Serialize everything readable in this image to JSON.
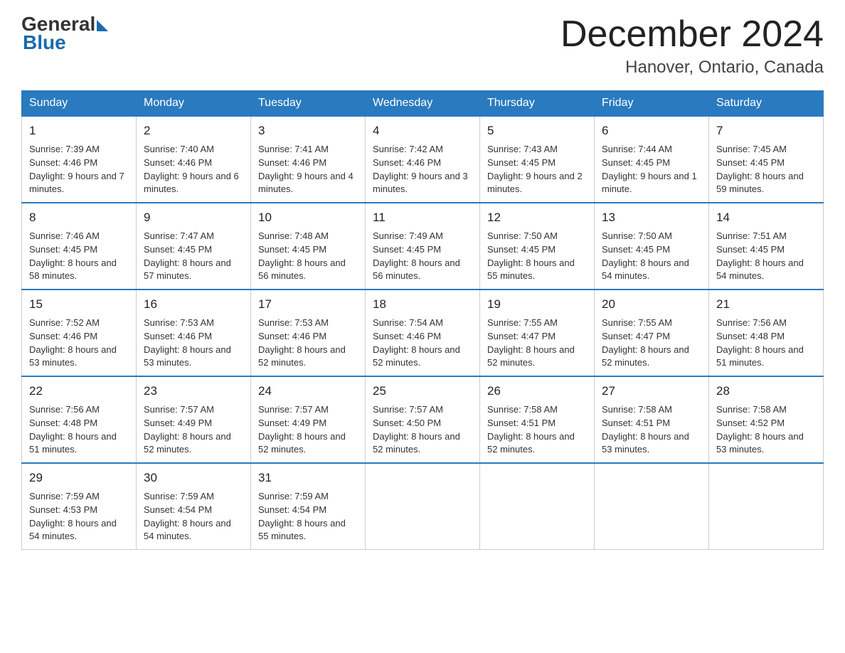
{
  "header": {
    "logo_general": "General",
    "logo_blue": "Blue",
    "month_year": "December 2024",
    "location": "Hanover, Ontario, Canada"
  },
  "columns": [
    "Sunday",
    "Monday",
    "Tuesday",
    "Wednesday",
    "Thursday",
    "Friday",
    "Saturday"
  ],
  "weeks": [
    [
      {
        "day": "1",
        "sunrise": "Sunrise: 7:39 AM",
        "sunset": "Sunset: 4:46 PM",
        "daylight": "Daylight: 9 hours and 7 minutes."
      },
      {
        "day": "2",
        "sunrise": "Sunrise: 7:40 AM",
        "sunset": "Sunset: 4:46 PM",
        "daylight": "Daylight: 9 hours and 6 minutes."
      },
      {
        "day": "3",
        "sunrise": "Sunrise: 7:41 AM",
        "sunset": "Sunset: 4:46 PM",
        "daylight": "Daylight: 9 hours and 4 minutes."
      },
      {
        "day": "4",
        "sunrise": "Sunrise: 7:42 AM",
        "sunset": "Sunset: 4:46 PM",
        "daylight": "Daylight: 9 hours and 3 minutes."
      },
      {
        "day": "5",
        "sunrise": "Sunrise: 7:43 AM",
        "sunset": "Sunset: 4:45 PM",
        "daylight": "Daylight: 9 hours and 2 minutes."
      },
      {
        "day": "6",
        "sunrise": "Sunrise: 7:44 AM",
        "sunset": "Sunset: 4:45 PM",
        "daylight": "Daylight: 9 hours and 1 minute."
      },
      {
        "day": "7",
        "sunrise": "Sunrise: 7:45 AM",
        "sunset": "Sunset: 4:45 PM",
        "daylight": "Daylight: 8 hours and 59 minutes."
      }
    ],
    [
      {
        "day": "8",
        "sunrise": "Sunrise: 7:46 AM",
        "sunset": "Sunset: 4:45 PM",
        "daylight": "Daylight: 8 hours and 58 minutes."
      },
      {
        "day": "9",
        "sunrise": "Sunrise: 7:47 AM",
        "sunset": "Sunset: 4:45 PM",
        "daylight": "Daylight: 8 hours and 57 minutes."
      },
      {
        "day": "10",
        "sunrise": "Sunrise: 7:48 AM",
        "sunset": "Sunset: 4:45 PM",
        "daylight": "Daylight: 8 hours and 56 minutes."
      },
      {
        "day": "11",
        "sunrise": "Sunrise: 7:49 AM",
        "sunset": "Sunset: 4:45 PM",
        "daylight": "Daylight: 8 hours and 56 minutes."
      },
      {
        "day": "12",
        "sunrise": "Sunrise: 7:50 AM",
        "sunset": "Sunset: 4:45 PM",
        "daylight": "Daylight: 8 hours and 55 minutes."
      },
      {
        "day": "13",
        "sunrise": "Sunrise: 7:50 AM",
        "sunset": "Sunset: 4:45 PM",
        "daylight": "Daylight: 8 hours and 54 minutes."
      },
      {
        "day": "14",
        "sunrise": "Sunrise: 7:51 AM",
        "sunset": "Sunset: 4:45 PM",
        "daylight": "Daylight: 8 hours and 54 minutes."
      }
    ],
    [
      {
        "day": "15",
        "sunrise": "Sunrise: 7:52 AM",
        "sunset": "Sunset: 4:46 PM",
        "daylight": "Daylight: 8 hours and 53 minutes."
      },
      {
        "day": "16",
        "sunrise": "Sunrise: 7:53 AM",
        "sunset": "Sunset: 4:46 PM",
        "daylight": "Daylight: 8 hours and 53 minutes."
      },
      {
        "day": "17",
        "sunrise": "Sunrise: 7:53 AM",
        "sunset": "Sunset: 4:46 PM",
        "daylight": "Daylight: 8 hours and 52 minutes."
      },
      {
        "day": "18",
        "sunrise": "Sunrise: 7:54 AM",
        "sunset": "Sunset: 4:46 PM",
        "daylight": "Daylight: 8 hours and 52 minutes."
      },
      {
        "day": "19",
        "sunrise": "Sunrise: 7:55 AM",
        "sunset": "Sunset: 4:47 PM",
        "daylight": "Daylight: 8 hours and 52 minutes."
      },
      {
        "day": "20",
        "sunrise": "Sunrise: 7:55 AM",
        "sunset": "Sunset: 4:47 PM",
        "daylight": "Daylight: 8 hours and 52 minutes."
      },
      {
        "day": "21",
        "sunrise": "Sunrise: 7:56 AM",
        "sunset": "Sunset: 4:48 PM",
        "daylight": "Daylight: 8 hours and 51 minutes."
      }
    ],
    [
      {
        "day": "22",
        "sunrise": "Sunrise: 7:56 AM",
        "sunset": "Sunset: 4:48 PM",
        "daylight": "Daylight: 8 hours and 51 minutes."
      },
      {
        "day": "23",
        "sunrise": "Sunrise: 7:57 AM",
        "sunset": "Sunset: 4:49 PM",
        "daylight": "Daylight: 8 hours and 52 minutes."
      },
      {
        "day": "24",
        "sunrise": "Sunrise: 7:57 AM",
        "sunset": "Sunset: 4:49 PM",
        "daylight": "Daylight: 8 hours and 52 minutes."
      },
      {
        "day": "25",
        "sunrise": "Sunrise: 7:57 AM",
        "sunset": "Sunset: 4:50 PM",
        "daylight": "Daylight: 8 hours and 52 minutes."
      },
      {
        "day": "26",
        "sunrise": "Sunrise: 7:58 AM",
        "sunset": "Sunset: 4:51 PM",
        "daylight": "Daylight: 8 hours and 52 minutes."
      },
      {
        "day": "27",
        "sunrise": "Sunrise: 7:58 AM",
        "sunset": "Sunset: 4:51 PM",
        "daylight": "Daylight: 8 hours and 53 minutes."
      },
      {
        "day": "28",
        "sunrise": "Sunrise: 7:58 AM",
        "sunset": "Sunset: 4:52 PM",
        "daylight": "Daylight: 8 hours and 53 minutes."
      }
    ],
    [
      {
        "day": "29",
        "sunrise": "Sunrise: 7:59 AM",
        "sunset": "Sunset: 4:53 PM",
        "daylight": "Daylight: 8 hours and 54 minutes."
      },
      {
        "day": "30",
        "sunrise": "Sunrise: 7:59 AM",
        "sunset": "Sunset: 4:54 PM",
        "daylight": "Daylight: 8 hours and 54 minutes."
      },
      {
        "day": "31",
        "sunrise": "Sunrise: 7:59 AM",
        "sunset": "Sunset: 4:54 PM",
        "daylight": "Daylight: 8 hours and 55 minutes."
      },
      null,
      null,
      null,
      null
    ]
  ]
}
